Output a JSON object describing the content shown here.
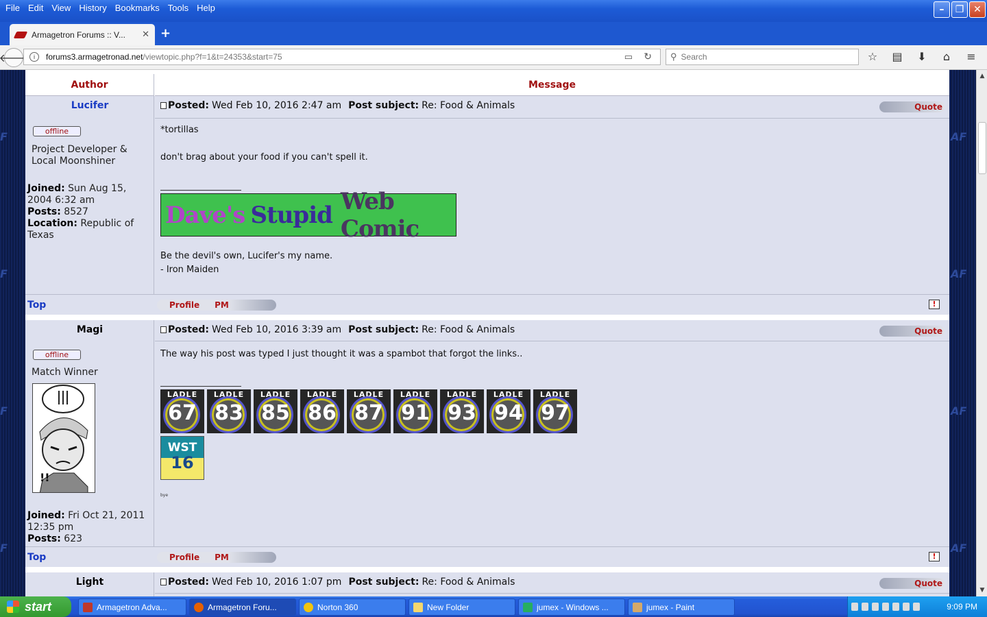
{
  "menu": [
    "File",
    "Edit",
    "View",
    "History",
    "Bookmarks",
    "Tools",
    "Help"
  ],
  "tab": {
    "title": "Armagetron Forums :: V...",
    "new_tab": "+"
  },
  "address": {
    "host": "forums3.armagetronad.net",
    "path": "/viewtopic.php?f=1&t=24353&start=75"
  },
  "search": {
    "placeholder": "Search"
  },
  "table_headers": {
    "author": "Author",
    "message": "Message"
  },
  "posts": [
    {
      "author": "Lucifer",
      "status": "offline",
      "rank": "Project Developer & Local Moonshiner",
      "joined_label": "Joined:",
      "joined": "Sun Aug 15, 2004 6:32 am",
      "posts_label": "Posts:",
      "posts": "8527",
      "location_label": "Location:",
      "location": "Republic of Texas",
      "posted_label": "Posted:",
      "posted": "Wed Feb 10, 2016 2:47 am",
      "subject_label": "Post subject:",
      "subject": "Re: Food & Animals",
      "body": [
        "*tortillas",
        "don't brag about your food if you can't spell it."
      ],
      "sig_banner": {
        "w1": "Dave's",
        "w2": "Stupid",
        "w3": "Web Comic"
      },
      "sig_lines": [
        "Be the devil's own, Lucifer's my name.",
        "- Iron Maiden"
      ]
    },
    {
      "author": "Magi",
      "status": "offline",
      "rank": "Match Winner",
      "joined_label": "Joined:",
      "joined": "Fri Oct 21, 2011 12:35 pm",
      "posts_label": "Posts:",
      "posts": "623",
      "posted_label": "Posted:",
      "posted": "Wed Feb 10, 2016 3:39 am",
      "subject_label": "Post subject:",
      "subject": "Re: Food & Animals",
      "body": [
        "The way his post was typed I just thought it was a spambot that forgot the links.."
      ],
      "ladle_label": "LADLE",
      "ladles": [
        "67",
        "83",
        "85",
        "86",
        "87",
        "91",
        "93",
        "94",
        "97"
      ],
      "wst": {
        "label": "WST",
        "num": "16"
      },
      "tiny": "bye"
    },
    {
      "author": "Light",
      "posted_label": "Posted:",
      "posted": "Wed Feb 10, 2016 1:07 pm",
      "subject_label": "Post subject:",
      "subject": "Re: Food & Animals"
    }
  ],
  "actions": {
    "quote": "Quote",
    "profile": "Profile",
    "pm": "PM",
    "top": "Top",
    "report": "!"
  },
  "side_mark": "AF",
  "side_mark_left": "F",
  "taskbar": {
    "start": "start",
    "tasks": [
      "Armagetron Adva...",
      "Armagetron Foru...",
      "Norton 360",
      "New Folder",
      "jumex - Windows ...",
      "jumex - Paint"
    ],
    "clock": "9:09 PM"
  }
}
